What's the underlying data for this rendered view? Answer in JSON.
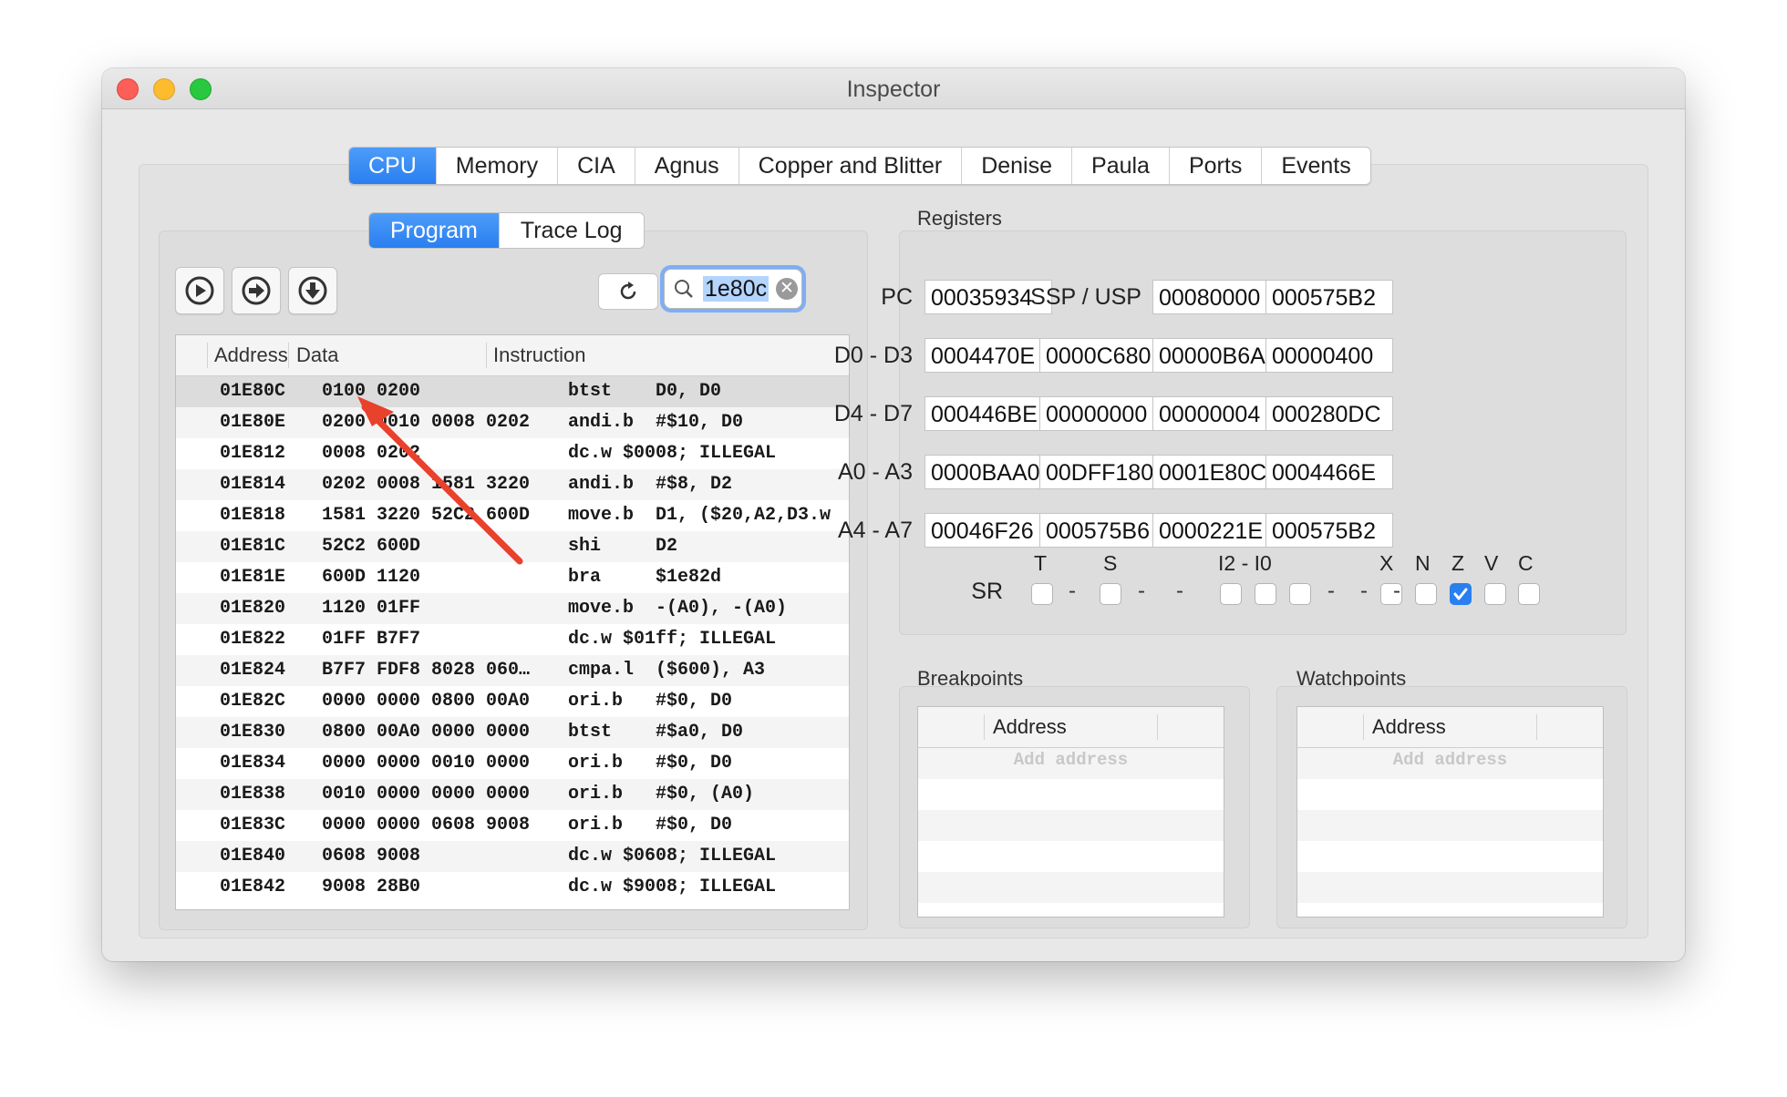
{
  "window": {
    "title": "Inspector"
  },
  "main_tabs": [
    "CPU",
    "Memory",
    "CIA",
    "Agnus",
    "Copper and Blitter",
    "Denise",
    "Paula",
    "Ports",
    "Events"
  ],
  "program_tabs": [
    "Program",
    "Trace Log"
  ],
  "toolbar": {
    "buttons": [
      "run-icon",
      "step-over-icon",
      "step-into-icon"
    ],
    "refresh": "refresh-icon",
    "search_value": "1e80c"
  },
  "program_table": {
    "columns": [
      "Address",
      "Data",
      "Instruction"
    ],
    "rows": [
      {
        "addr": "01E80C",
        "data": "0100 0200",
        "instr": "btst    D0, D0"
      },
      {
        "addr": "01E80E",
        "data": "0200 0010 0008 0202",
        "instr": "andi.b  #$10, D0"
      },
      {
        "addr": "01E812",
        "data": "0008 0202",
        "instr": "dc.w $0008; ILLEGAL"
      },
      {
        "addr": "01E814",
        "data": "0202 0008 1581 3220",
        "instr": "andi.b  #$8, D2"
      },
      {
        "addr": "01E818",
        "data": "1581 3220 52C2 600D",
        "instr": "move.b  D1, ($20,A2,D3.w"
      },
      {
        "addr": "01E81C",
        "data": "52C2 600D",
        "instr": "shi     D2"
      },
      {
        "addr": "01E81E",
        "data": "600D 1120",
        "instr": "bra     $1e82d"
      },
      {
        "addr": "01E820",
        "data": "1120 01FF",
        "instr": "move.b  -(A0), -(A0)"
      },
      {
        "addr": "01E822",
        "data": "01FF B7F7",
        "instr": "dc.w $01ff; ILLEGAL"
      },
      {
        "addr": "01E824",
        "data": "B7F7 FDF8 8028 060…",
        "instr": "cmpa.l  ($600), A3"
      },
      {
        "addr": "01E82C",
        "data": "0000 0000 0800 00A0",
        "instr": "ori.b   #$0, D0"
      },
      {
        "addr": "01E830",
        "data": "0800 00A0 0000 0000",
        "instr": "btst    #$a0, D0"
      },
      {
        "addr": "01E834",
        "data": "0000 0000 0010 0000",
        "instr": "ori.b   #$0, D0"
      },
      {
        "addr": "01E838",
        "data": "0010 0000 0000 0000",
        "instr": "ori.b   #$0, (A0)"
      },
      {
        "addr": "01E83C",
        "data": "0000 0000 0608 9008",
        "instr": "ori.b   #$0, D0"
      },
      {
        "addr": "01E840",
        "data": "0608 9008",
        "instr": "dc.w $0608; ILLEGAL"
      },
      {
        "addr": "01E842",
        "data": "9008 28B0",
        "instr": "dc.w $9008; ILLEGAL"
      }
    ]
  },
  "registers": {
    "title": "Registers",
    "rows": [
      {
        "label": "PC",
        "values": [
          "00035934"
        ],
        "extra_label": "SSP / USP",
        "extra_values": [
          "00080000",
          "000575B2"
        ]
      },
      {
        "label": "D0 - D3",
        "values": [
          "0004470E",
          "0000C680",
          "00000B6A",
          "00000400"
        ]
      },
      {
        "label": "D4 - D7",
        "values": [
          "000446BE",
          "00000000",
          "00000004",
          "000280DC"
        ]
      },
      {
        "label": "A0 - A3",
        "values": [
          "0000BAA0",
          "00DFF180",
          "0001E80C",
          "0004466E"
        ]
      },
      {
        "label": "A4 - A7",
        "values": [
          "00046F26",
          "000575B6",
          "0000221E",
          "000575B2"
        ]
      }
    ],
    "sr_label": "SR",
    "flag_headers": {
      "t": "T",
      "s": "S",
      "i": "I2 - I0",
      "x": "X",
      "n": "N",
      "z": "Z",
      "v": "V",
      "c": "C"
    },
    "sr_bits": {
      "T": false,
      "S": false,
      "I2": false,
      "I1": false,
      "I0": false,
      "X": false,
      "N": false,
      "Z": true,
      "V": false,
      "C": false
    }
  },
  "breakpoints": {
    "title": "Breakpoints",
    "column": "Address",
    "placeholder": "Add address"
  },
  "watchpoints": {
    "title": "Watchpoints",
    "column": "Address",
    "placeholder": "Add address"
  },
  "annotation": {
    "color": "#e8412c"
  }
}
